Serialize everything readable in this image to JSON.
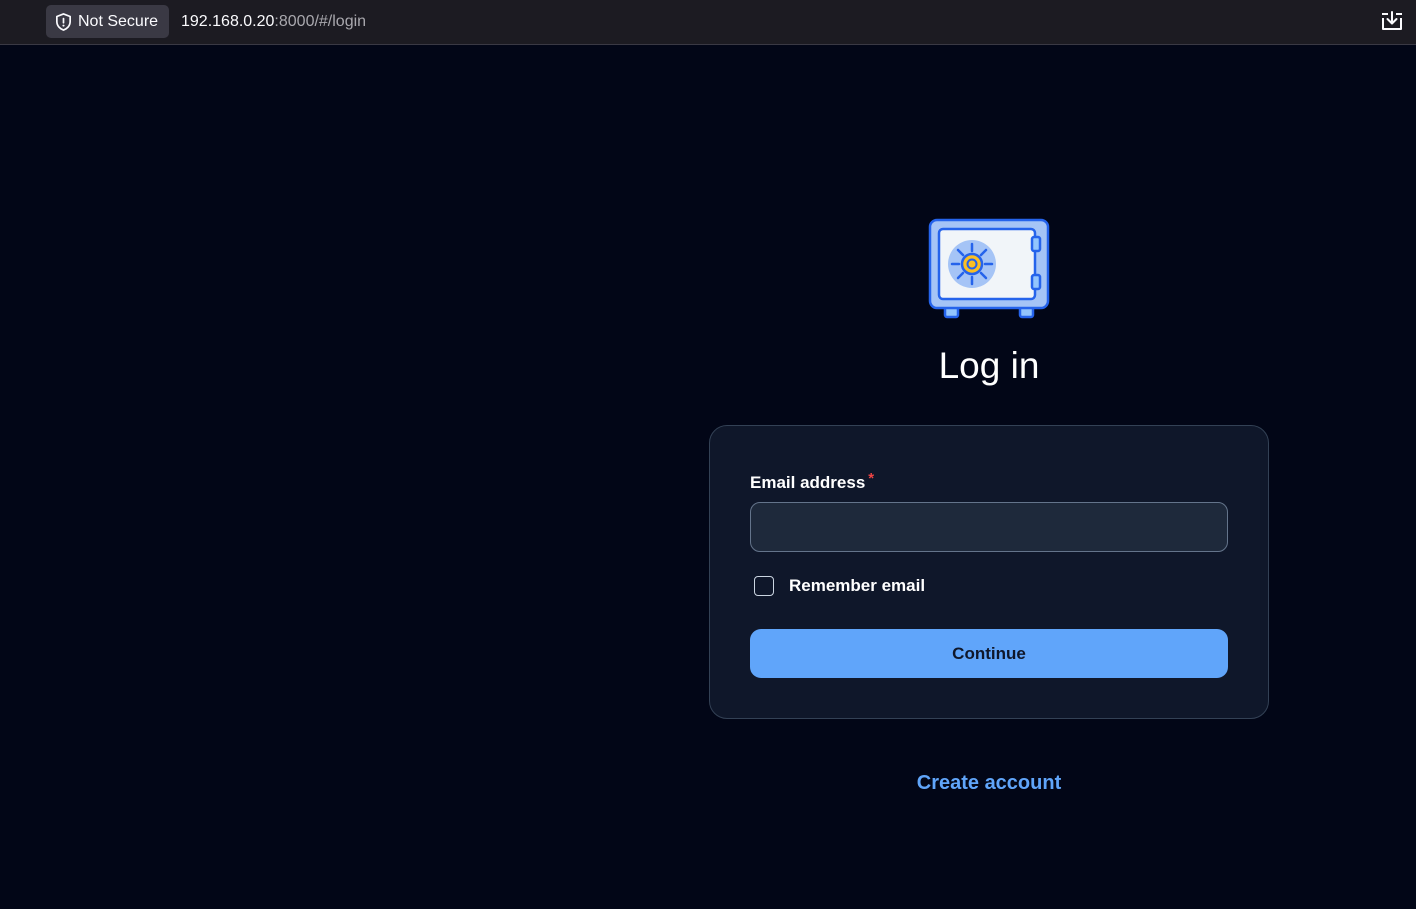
{
  "browser": {
    "security_label": "Not Secure",
    "url_host": "192.168.0.20",
    "url_rest": ":8000/#/login"
  },
  "login": {
    "title": "Log in",
    "email_label": "Email address",
    "required_marker": "*",
    "email_value": "",
    "remember_label": "Remember email",
    "remember_checked": false,
    "continue_label": "Continue",
    "create_account_label": "Create account"
  },
  "colors": {
    "page_bg": "#020617",
    "card_bg": "#0f172a",
    "accent": "#60a5fa",
    "required": "#ef4444"
  },
  "icons": {
    "browser": [
      "shield-icon",
      "download-icon"
    ],
    "logo": "vault-safe-logo-icon"
  }
}
